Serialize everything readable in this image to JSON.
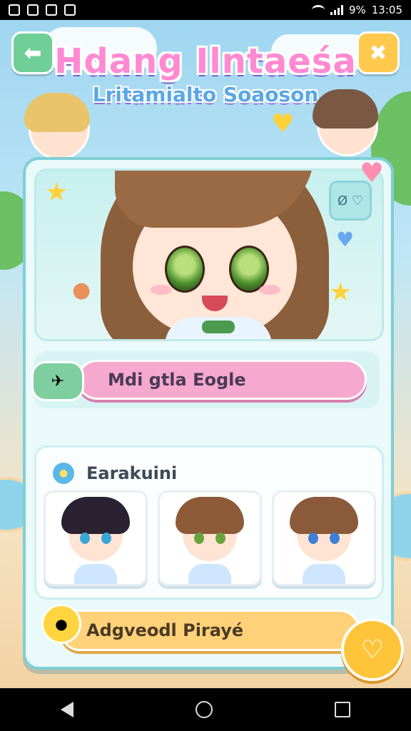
{
  "status_bar": {
    "battery": "9%",
    "time": "13:05"
  },
  "header": {
    "title": "Hdang Ilntaeśa",
    "subtitle": "Lritamialto Soaoson"
  },
  "portrait": {
    "emote_label": "Ø ♡"
  },
  "actions": {
    "primary_label": "Mdi gtla Eogle",
    "secondary_label": "Adgveodl Pirayé"
  },
  "characters": {
    "section_title": "Earakuini",
    "cards": [
      {
        "hair": "#2a2230",
        "eyes": "#3aa6d8"
      },
      {
        "hair": "#8d5b38",
        "eyes": "#6aa23b"
      },
      {
        "hair": "#8a5a3a",
        "eyes": "#3f7fd6"
      }
    ]
  },
  "colors": {
    "accent_pink": "#f7a8cf",
    "accent_orange": "#ffd27a",
    "panel_border": "#7ecfd6"
  },
  "icons": [
    "back-arrow-icon",
    "close-icon",
    "heart-icon",
    "star-icon",
    "home-icon"
  ]
}
